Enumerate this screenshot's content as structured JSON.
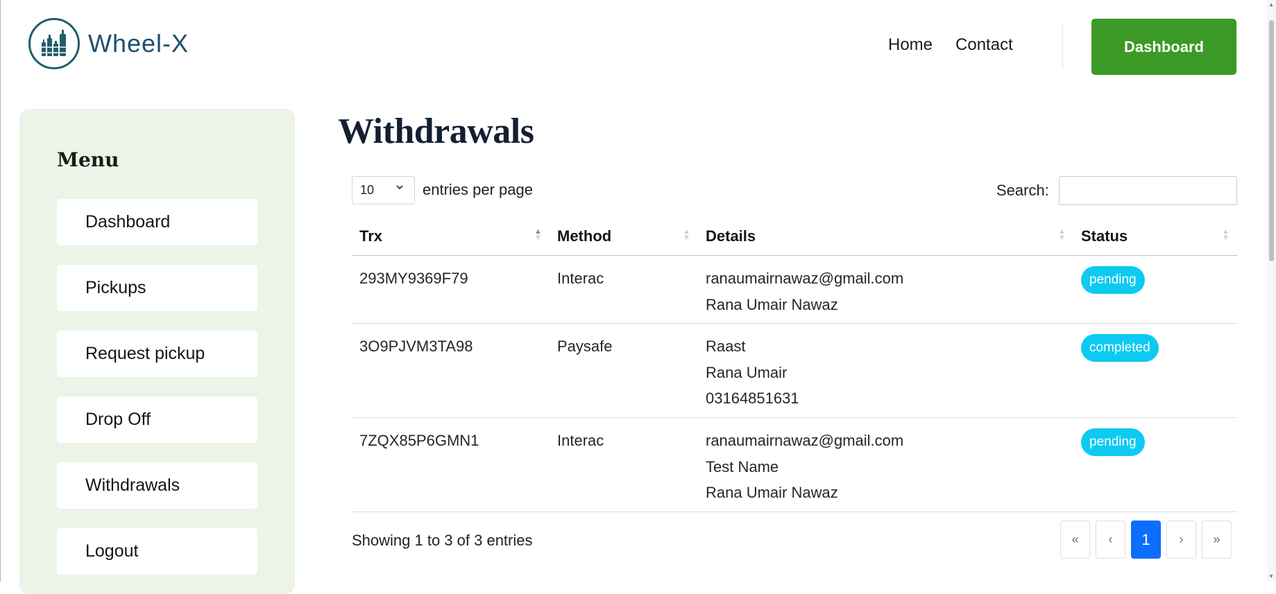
{
  "header": {
    "logo_text": "Wheel-X",
    "nav": [
      "Home",
      "Contact"
    ],
    "dashboard_button": "Dashboard"
  },
  "sidebar": {
    "title": "Menu",
    "items": [
      "Dashboard",
      "Pickups",
      "Request pickup",
      "Drop Off",
      "Withdrawals",
      "Logout"
    ]
  },
  "main": {
    "title": "Withdrawals",
    "entries_per_page_value": "10",
    "entries_per_page_label": "entries per page",
    "search_label": "Search:",
    "search_value": "",
    "columns": [
      "Trx",
      "Method",
      "Details",
      "Status"
    ],
    "rows": [
      {
        "trx": "293MY9369F79",
        "method": "Interac",
        "details": [
          "ranaumairnawaz@gmail.com",
          "Rana Umair Nawaz"
        ],
        "status": "pending"
      },
      {
        "trx": "3O9PJVM3TA98",
        "method": "Paysafe",
        "details": [
          "Raast",
          "Rana Umair",
          "03164851631"
        ],
        "status": "completed"
      },
      {
        "trx": "7ZQX85P6GMN1",
        "method": "Interac",
        "details": [
          "ranaumairnawaz@gmail.com",
          "Test Name",
          "Rana Umair Nawaz"
        ],
        "status": "pending"
      }
    ],
    "showing_text": "Showing 1 to 3 of 3 entries",
    "pagination": {
      "first": "«",
      "prev": "‹",
      "current": "1",
      "next": "›",
      "last": "»"
    }
  },
  "colors": {
    "primary_green": "#3b9a25",
    "sidebar_bg": "#ebf4e7",
    "badge_cyan": "#0dcaf0",
    "active_page_blue": "#0d6efd",
    "title_navy": "#151f33"
  },
  "icons": {
    "logo": "bottles-recycling-logo-icon",
    "per_page_chevron": "chevron-down-icon",
    "sort_asc": "sort-ascending-icon",
    "sort_both": "sort-both-icon"
  }
}
